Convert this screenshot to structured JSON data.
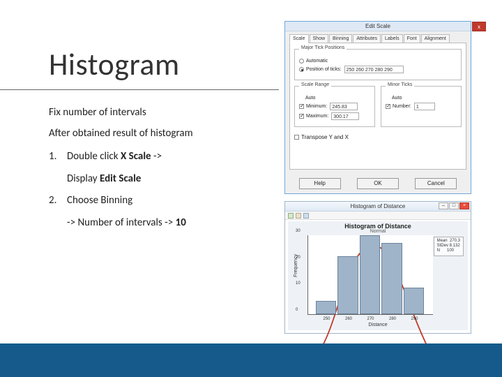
{
  "slide": {
    "title": "Histogram",
    "intro1": "Fix number of intervals",
    "intro2": "After obtained result of histogram",
    "steps": [
      {
        "num": "1.",
        "line": "Double click",
        "bold1": "X Scale",
        "arrow": "->",
        "sub_prefix": "Display",
        "sub_bold": "Edit Scale"
      },
      {
        "num": "2.",
        "line": "Choose Binning",
        "sub_text": "-> Number of intervals ->",
        "sub_bold": "10"
      }
    ]
  },
  "dialog": {
    "title": "Edit Scale",
    "close": "x",
    "tabs": [
      "Scale",
      "Show",
      "Binning",
      "Attributes",
      "Labels",
      "Font",
      "Alignment"
    ],
    "major_tick_legend": "Major Tick Positions",
    "radio_auto": "Automatic",
    "radio_pos": "Position of ticks:",
    "pos_value": "250 260 270 280 290",
    "range_legend": "Scale Range",
    "range_auto": "Auto",
    "min_label": "Minimum:",
    "min_value": "245.83",
    "max_label": "Maximum:",
    "max_value": "300.17",
    "minor_legend": "Minor Ticks",
    "minor_auto": "Auto",
    "minor_num_label": "Number:",
    "minor_num_value": "1",
    "transpose": "Transpose Y and X",
    "buttons": {
      "help": "Help",
      "ok": "OK",
      "cancel": "Cancel"
    }
  },
  "histwin": {
    "title": "Histogram of Distance",
    "ctrl_min": "–",
    "ctrl_max": "□",
    "ctrl_close": "×",
    "chart_title": "Histogram of Distance",
    "chart_sub": "Normal",
    "stats": {
      "mean_l": "Mean",
      "mean_v": "270.3",
      "std_l": "StDev",
      "std_v": "8.132",
      "n_l": "N",
      "n_v": "100"
    },
    "ylabel": "Frequency",
    "xlabel": "Distance"
  },
  "chart_data": {
    "type": "bar",
    "title": "Histogram of Distance",
    "subtitle": "Normal",
    "x": [
      250,
      260,
      270,
      280,
      290
    ],
    "categories": [
      250,
      260,
      270,
      280,
      290
    ],
    "values": [
      5,
      22,
      30,
      27,
      10
    ],
    "xlabel": "Distance",
    "ylabel": "Frequency",
    "ylim": [
      0,
      30
    ],
    "xticks": [
      250,
      260,
      270,
      280,
      290
    ],
    "yticks": [
      0,
      10,
      20,
      30
    ],
    "overlay_curve": "normal",
    "stats": {
      "Mean": 270.3,
      "StDev": 8.132,
      "N": 100
    }
  }
}
